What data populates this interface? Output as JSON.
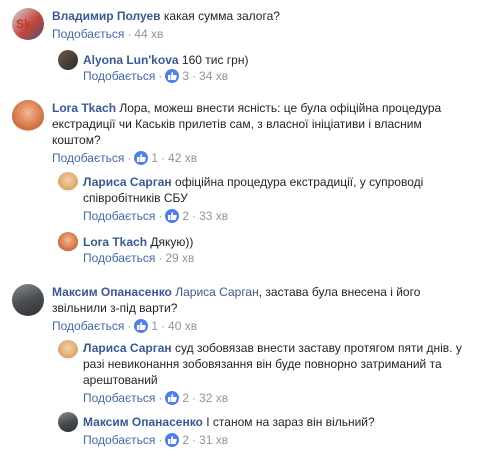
{
  "colors": {
    "link": "#385898",
    "meta": "#90949c",
    "like_icon": "#4f7df2"
  },
  "like_label": "Подобається",
  "sep": "·",
  "comments": [
    {
      "author": "Владимир Полуев",
      "text": "какая сумма залога?",
      "time": "44 хв",
      "avatar_icon": "user-avatar-icon"
    },
    {
      "author": "Alyona Lun'kova",
      "text": "160 тис грн)",
      "likes": "3",
      "time": "34 хв",
      "avatar_icon": "user-avatar-icon"
    },
    {
      "author": "Lora Tkach",
      "text_lines": [
        "Лора, можеш внести ясність: це була офіційна процедура",
        "екстрадиції чи Каськів прилетів сам, з власної ініціативи і власним",
        "коштом?"
      ],
      "likes": "1",
      "time": "42 хв",
      "avatar_icon": "user-avatar-icon"
    },
    {
      "author": "Лариса Сарган",
      "text_lines": [
        "офіційна процедура екстрадиції, у супроводі",
        "співробітників СБУ"
      ],
      "likes": "2",
      "time": "33 хв",
      "avatar_icon": "user-avatar-icon"
    },
    {
      "author": "Lora Tkach",
      "text": "Дякую))",
      "time": "29 хв",
      "avatar_icon": "user-avatar-icon"
    },
    {
      "author": "Максим Опанасенко",
      "mention": "Лариса Сарган",
      "text_lines": [
        ", застава була внесена і його",
        "звільнили з-під варти?"
      ],
      "likes": "1",
      "time": "40 хв",
      "avatar_icon": "user-avatar-icon"
    },
    {
      "author": "Лариса Сарган",
      "text_lines": [
        "суд зобовязав внести заставу протягом пяти днів. у",
        "разі невиконання зобовязання він буде повнорно затриманий та",
        "арештований"
      ],
      "likes": "2",
      "time": "32 хв",
      "avatar_icon": "user-avatar-icon"
    },
    {
      "author": "Максим Опанасенко",
      "text": "І станом на зараз він вільний?",
      "likes": "2",
      "time": "31 хв",
      "avatar_icon": "user-avatar-icon"
    }
  ]
}
